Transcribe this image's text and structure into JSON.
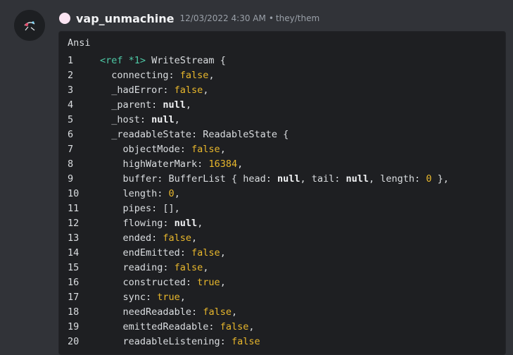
{
  "message": {
    "username": "vap_unmachine",
    "timestamp": "12/03/2022 4:30 AM",
    "separator": "•",
    "pronouns": "they/them",
    "role_dot_color": "#fbe4f2"
  },
  "code": {
    "language": "Ansi",
    "lines": [
      {
        "num": "1",
        "segs": [
          {
            "t": "<ref *1>",
            "c": "g"
          },
          {
            "t": " WriteStream {",
            "c": "n"
          }
        ]
      },
      {
        "num": "2",
        "segs": [
          {
            "t": "  connecting: ",
            "c": "n"
          },
          {
            "t": "false",
            "c": "y"
          },
          {
            "t": ",",
            "c": "n"
          }
        ]
      },
      {
        "num": "3",
        "segs": [
          {
            "t": "  _hadError: ",
            "c": "n"
          },
          {
            "t": "false",
            "c": "y"
          },
          {
            "t": ",",
            "c": "n"
          }
        ]
      },
      {
        "num": "4",
        "segs": [
          {
            "t": "  _parent: ",
            "c": "n"
          },
          {
            "t": "null",
            "c": "kw"
          },
          {
            "t": ",",
            "c": "n"
          }
        ]
      },
      {
        "num": "5",
        "segs": [
          {
            "t": "  _host: ",
            "c": "n"
          },
          {
            "t": "null",
            "c": "kw"
          },
          {
            "t": ",",
            "c": "n"
          }
        ]
      },
      {
        "num": "6",
        "segs": [
          {
            "t": "  _readableState: ReadableState {",
            "c": "n"
          }
        ]
      },
      {
        "num": "7",
        "segs": [
          {
            "t": "    objectMode: ",
            "c": "n"
          },
          {
            "t": "false",
            "c": "y"
          },
          {
            "t": ",",
            "c": "n"
          }
        ]
      },
      {
        "num": "8",
        "segs": [
          {
            "t": "    highWaterMark: ",
            "c": "n"
          },
          {
            "t": "16384",
            "c": "y"
          },
          {
            "t": ",",
            "c": "n"
          }
        ]
      },
      {
        "num": "9",
        "segs": [
          {
            "t": "    buffer: BufferList { head: ",
            "c": "n"
          },
          {
            "t": "null",
            "c": "kw"
          },
          {
            "t": ", tail: ",
            "c": "n"
          },
          {
            "t": "null",
            "c": "kw"
          },
          {
            "t": ", length: ",
            "c": "n"
          },
          {
            "t": "0",
            "c": "y"
          },
          {
            "t": " },",
            "c": "n"
          }
        ]
      },
      {
        "num": "10",
        "segs": [
          {
            "t": "    length: ",
            "c": "n"
          },
          {
            "t": "0",
            "c": "y"
          },
          {
            "t": ",",
            "c": "n"
          }
        ]
      },
      {
        "num": "11",
        "segs": [
          {
            "t": "    pipes: [],",
            "c": "n"
          }
        ]
      },
      {
        "num": "12",
        "segs": [
          {
            "t": "    flowing: ",
            "c": "n"
          },
          {
            "t": "null",
            "c": "kw"
          },
          {
            "t": ",",
            "c": "n"
          }
        ]
      },
      {
        "num": "13",
        "segs": [
          {
            "t": "    ended: ",
            "c": "n"
          },
          {
            "t": "false",
            "c": "y"
          },
          {
            "t": ",",
            "c": "n"
          }
        ]
      },
      {
        "num": "14",
        "segs": [
          {
            "t": "    endEmitted: ",
            "c": "n"
          },
          {
            "t": "false",
            "c": "y"
          },
          {
            "t": ",",
            "c": "n"
          }
        ]
      },
      {
        "num": "15",
        "segs": [
          {
            "t": "    reading: ",
            "c": "n"
          },
          {
            "t": "false",
            "c": "y"
          },
          {
            "t": ",",
            "c": "n"
          }
        ]
      },
      {
        "num": "16",
        "segs": [
          {
            "t": "    constructed: ",
            "c": "n"
          },
          {
            "t": "true",
            "c": "y"
          },
          {
            "t": ",",
            "c": "n"
          }
        ]
      },
      {
        "num": "17",
        "segs": [
          {
            "t": "    sync: ",
            "c": "n"
          },
          {
            "t": "true",
            "c": "y"
          },
          {
            "t": ",",
            "c": "n"
          }
        ]
      },
      {
        "num": "18",
        "segs": [
          {
            "t": "    needReadable: ",
            "c": "n"
          },
          {
            "t": "false",
            "c": "y"
          },
          {
            "t": ",",
            "c": "n"
          }
        ]
      },
      {
        "num": "19",
        "segs": [
          {
            "t": "    emittedReadable: ",
            "c": "n"
          },
          {
            "t": "false",
            "c": "y"
          },
          {
            "t": ",",
            "c": "n"
          }
        ]
      },
      {
        "num": "20",
        "segs": [
          {
            "t": "    readableListening: ",
            "c": "n"
          },
          {
            "t": "false",
            "c": "y"
          }
        ]
      }
    ]
  },
  "colors": {
    "background": "#313338",
    "code_background": "#1e1f22",
    "boolean_number": "#e8b72c",
    "ref_tag": "#4ec9a6"
  }
}
